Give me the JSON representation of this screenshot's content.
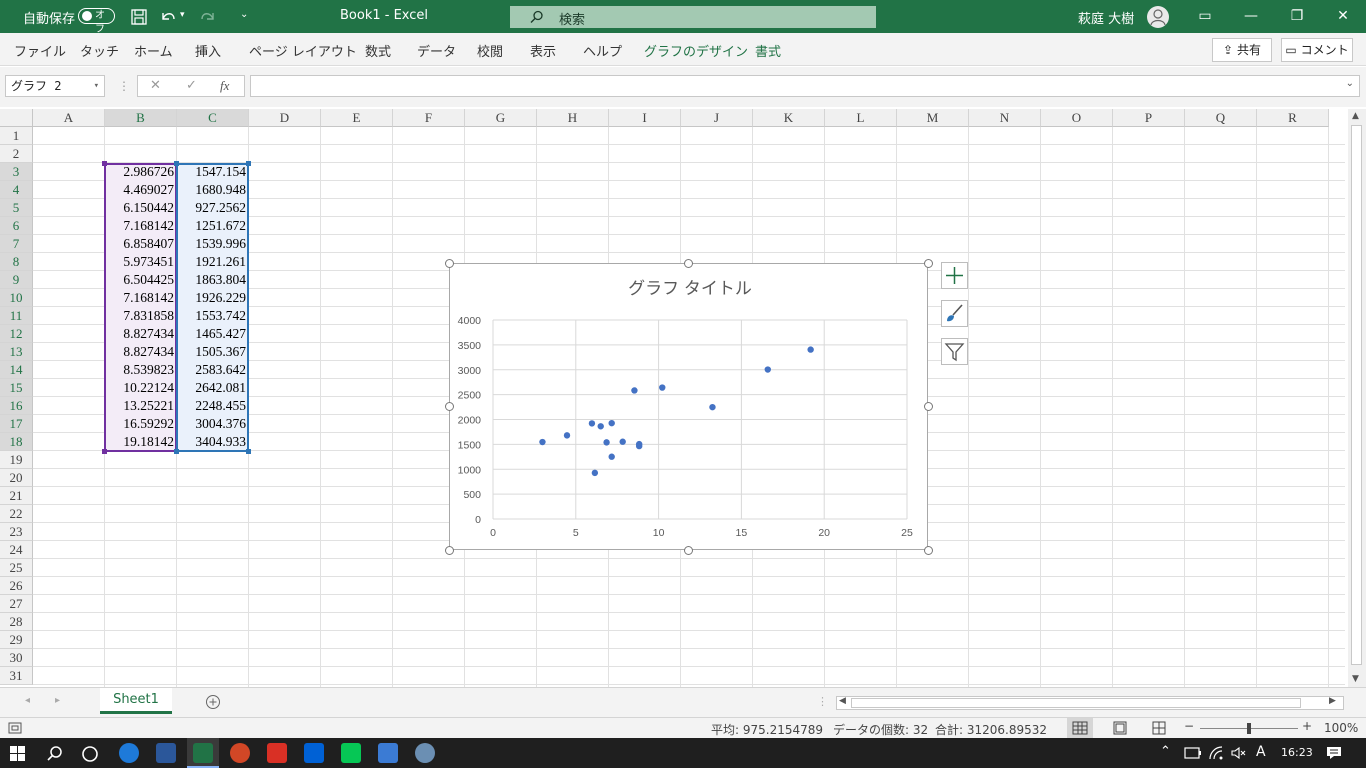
{
  "titlebar": {
    "autosave_label": "自動保存",
    "autosave_state": "オフ",
    "doc_title": "Book1  -  Excel",
    "search_placeholder": "検索",
    "user_name": "萩庭 大樹"
  },
  "ribbon": {
    "tabs": [
      "ファイル",
      "タッチ",
      "ホーム",
      "挿入",
      "ページ レイアウト",
      "数式",
      "データ",
      "校閲",
      "表示",
      "ヘルプ",
      "グラフのデザイン",
      "書式"
    ],
    "share_label": "共有",
    "comment_label": "コメント"
  },
  "formula_bar": {
    "name_box": "グラフ 2",
    "fx_label": "fx",
    "value": ""
  },
  "grid": {
    "columns": [
      "A",
      "B",
      "C",
      "D",
      "E",
      "F",
      "G",
      "H",
      "I",
      "J",
      "K",
      "L",
      "M",
      "N",
      "O",
      "P",
      "Q",
      "R"
    ],
    "rows": [
      "1",
      "2",
      "3",
      "4",
      "5",
      "6",
      "7",
      "8",
      "9",
      "10",
      "11",
      "12",
      "13",
      "14",
      "15",
      "16",
      "17",
      "18",
      "19",
      "20",
      "21",
      "22",
      "23",
      "24",
      "25",
      "26",
      "27",
      "28",
      "29",
      "30",
      "31"
    ],
    "data_start_row": 3,
    "col_b": [
      "2.986726",
      "4.469027",
      "6.150442",
      "7.168142",
      "6.858407",
      "5.973451",
      "6.504425",
      "7.168142",
      "7.831858",
      "8.827434",
      "8.827434",
      "8.539823",
      "10.22124",
      "13.25221",
      "16.59292",
      "19.18142"
    ],
    "col_c": [
      "1547.154",
      "1680.948",
      "927.2562",
      "1251.672",
      "1539.996",
      "1921.261",
      "1863.804",
      "1926.229",
      "1553.742",
      "1465.427",
      "1505.367",
      "2583.642",
      "2642.081",
      "2248.455",
      "3004.376",
      "3404.933"
    ]
  },
  "chart_data": {
    "type": "scatter",
    "title": "グラフ タイトル",
    "x": [
      2.986726,
      4.469027,
      6.150442,
      7.168142,
      6.858407,
      5.973451,
      6.504425,
      7.168142,
      7.831858,
      8.827434,
      8.827434,
      8.539823,
      10.22124,
      13.25221,
      16.59292,
      19.18142
    ],
    "y": [
      1547.154,
      1680.948,
      927.2562,
      1251.672,
      1539.996,
      1921.261,
      1863.804,
      1926.229,
      1553.742,
      1465.427,
      1505.367,
      2583.642,
      2642.081,
      2248.455,
      3004.376,
      3404.933
    ],
    "xlim": [
      0,
      25
    ],
    "ylim": [
      0,
      4000
    ],
    "x_ticks": [
      "0",
      "5",
      "10",
      "15",
      "20",
      "25"
    ],
    "y_ticks": [
      "0",
      "500",
      "1000",
      "1500",
      "2000",
      "2500",
      "3000",
      "3500",
      "4000"
    ],
    "grid": true,
    "marker_color": "#4472c4"
  },
  "sheet": {
    "tab_name": "Sheet1"
  },
  "status": {
    "average": "平均: 975.2154789",
    "count": "データの個数: 32",
    "sum": "合計: 31206.89532",
    "zoom": "100%"
  },
  "taskbar": {
    "time": "16:23",
    "ime": "A"
  },
  "colors": {
    "excel_green": "#217346",
    "selection_b": "#7030a0",
    "selection_c": "#2e75b6"
  }
}
